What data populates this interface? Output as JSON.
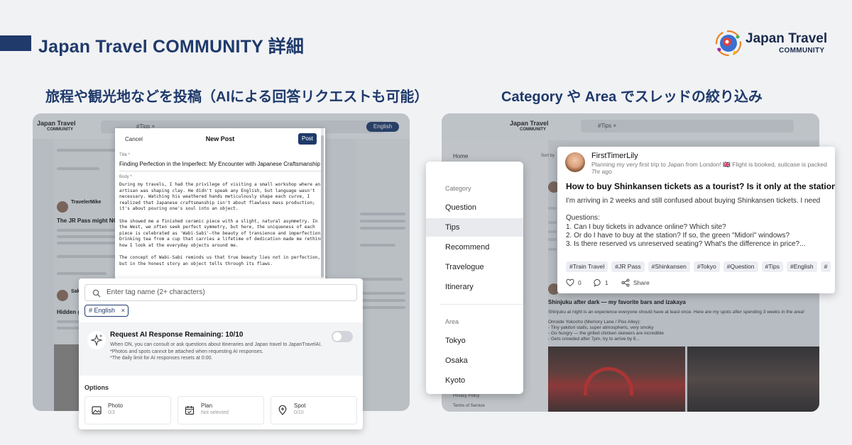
{
  "header": {
    "title": "Japan Travel COMMUNITY 詳細"
  },
  "brand": {
    "line1": "Japan Travel",
    "line2": "COMMUNITY"
  },
  "captions": {
    "left": "旅程や観光地などを投稿（AIによる回答リクエストも可能）",
    "right": "Category や Area でスレッドの絞り込み"
  },
  "left_screen": {
    "logo_line1": "Japan Travel",
    "logo_line2": "COMMUNITY",
    "search_chip": "#Tips ×",
    "language_button": "English",
    "feed": {
      "post1_user": "TravelerMike",
      "post1_title": "The JR Pass might NOT",
      "post2_user": "SakuraExplorer",
      "post2_title": "Hidden g"
    },
    "new_post": {
      "cancel": "Cancel",
      "heading": "New Post",
      "post_button": "Post",
      "title_label": "Title *",
      "title_value": "Finding Perfection in the Imperfect: My Encounter with Japanese Craftsmanship",
      "body_label": "Body *",
      "body_value": "During my travels, I had the privilege of visiting a small workshop where an artisan was shaping clay. He didn't speak any English, but language wasn't necessary. Watching his weathered hands meticulously shape each curve, I realized that Japanese craftsmanship isn't about flawless mass production; it's about pouring one's soul into an object.\n\nShe showed me a finished ceramic piece with a slight, natural asymmetry. In the West, we often seek perfect symmetry, but here, the uniqueness of each piece is celebrated as 'Wabi-Sabi'—the beauty of transience and imperfection. Drinking tea from a cup that carries a lifetime of dedication made me rethink how I look at the everyday objects around me.\n\nThe concept of Wabi-Sabi reminds us that true beauty lies not in perfection, but in the honest story an object tells through its flaws."
    },
    "tags": {
      "placeholder": "Enter tag name (2+ characters)",
      "chip": "# English",
      "chip_remove": "×"
    },
    "ai": {
      "title": "Request AI Response Remaining: 10/10",
      "desc1": "When ON, you can consult or ask questions about itineraries and Japan travel to JapanTravelAI.",
      "desc2": "*Photos and spots cannot be attached when requesting AI responses.",
      "desc3": "*The daily limit for AI responses resets at 0:00.",
      "toggle_state": "off"
    },
    "options": {
      "label": "Options",
      "items": [
        {
          "title": "Photo",
          "sub": "0/3",
          "icon": "photo-icon"
        },
        {
          "title": "Plan",
          "sub": "Not selected",
          "icon": "calendar-icon"
        },
        {
          "title": "Spot",
          "sub": "0/10",
          "icon": "pin-icon"
        }
      ]
    }
  },
  "right_screen": {
    "logo_line1": "Japan Travel",
    "logo_line2": "COMMUNITY",
    "search_chip": "#Tips ×",
    "sidebar": {
      "home": "Home",
      "privacy": "Privacy Policy",
      "terms": "Terms of Service"
    },
    "sort": "Sort by",
    "menu": {
      "category_header": "Category",
      "categories": [
        "Question",
        "Tips",
        "Recommend",
        "Travelogue",
        "Itinerary"
      ],
      "selected": "Tips",
      "area_header": "Area",
      "areas": [
        "Tokyo",
        "Osaka",
        "Kyoto"
      ]
    },
    "card": {
      "user": "FirstTimerLily",
      "subtitle": "Planning my very first trip to Japan from London! 🇬🇧 Flight is booked, suitcase is packed",
      "time": "7hr ago",
      "title": "How to buy Shinkansen tickets as a tourist? Is it only at the station?",
      "body": "I'm arriving in 2 weeks and still confused about buying Shinkansen tickets. I need\n\nQuestions:\n1. Can I buy tickets in advance online? Which site?\n2. Or do I have to buy at the station? If so, the green \"Midori\" windows?\n3. Is there reserved vs unreserved seating? What's the difference in price?...",
      "tags": [
        "#Train Travel",
        "#JR Pass",
        "#Shinkansen",
        "#Tokyo",
        "#Question",
        "#Tips",
        "#English",
        "#"
      ],
      "likes": "0",
      "comments": "1",
      "share": "Share"
    },
    "feed2": {
      "title": "Shinjuku after dark — my favorite bars and izakaya",
      "desc": "Shinjuku at night is an experience everyone should have at least once. Here are my spots after spending 3 weeks in the area!",
      "l1": "Omoide Yokocho (Memory Lane / Piss Alley):",
      "l2": "- Tiny yakitori stalls, super atmospheric, very smoky",
      "l3": "- Go hungry — the grilled chicken skewers are incredible",
      "l4": "- Gets crowded after 7pm, try to arrive by 6..."
    }
  }
}
